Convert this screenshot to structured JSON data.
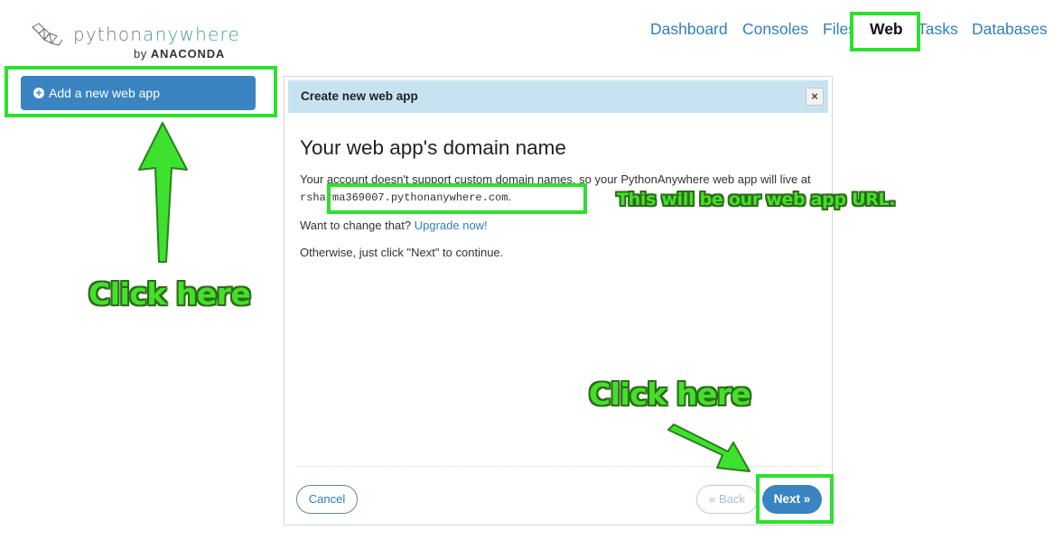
{
  "logo": {
    "word_python": "python",
    "word_anywhere": "anywhere",
    "by": "by",
    "brand": "ANACONDA"
  },
  "nav": {
    "items": [
      {
        "label": "Dashboard",
        "active": false
      },
      {
        "label": "Consoles",
        "active": false
      },
      {
        "label": "Files",
        "active": false
      },
      {
        "label": "Web",
        "active": true
      },
      {
        "label": "Tasks",
        "active": false
      },
      {
        "label": "Databases",
        "active": false
      }
    ]
  },
  "sidebar": {
    "add_button_label": "Add a new web app"
  },
  "modal": {
    "title": "Create new web app",
    "close_glyph": "×",
    "heading": "Your web app's domain name",
    "line1_text": "Your account doesn't support custom domain names, so your PythonAnywhere web app will live at",
    "domain": "rsharma369007.pythonanywhere.com",
    "line1_end": ".",
    "change_prompt": "Want to change that?",
    "upgrade_link": "Upgrade now!",
    "continue_text": "Otherwise, just click \"Next\" to continue.",
    "cancel_label": "Cancel",
    "back_label": "« Back",
    "next_label": "Next »"
  },
  "annotations": {
    "click_here_left": "Click here",
    "click_here_right": "Click here",
    "url_note": "This will be our web app URL."
  },
  "colors": {
    "accent_blue": "#3a84c1",
    "link_blue": "#2f7fbf",
    "modal_header": "#c7e3f2",
    "highlight_green": "#2de02d"
  }
}
